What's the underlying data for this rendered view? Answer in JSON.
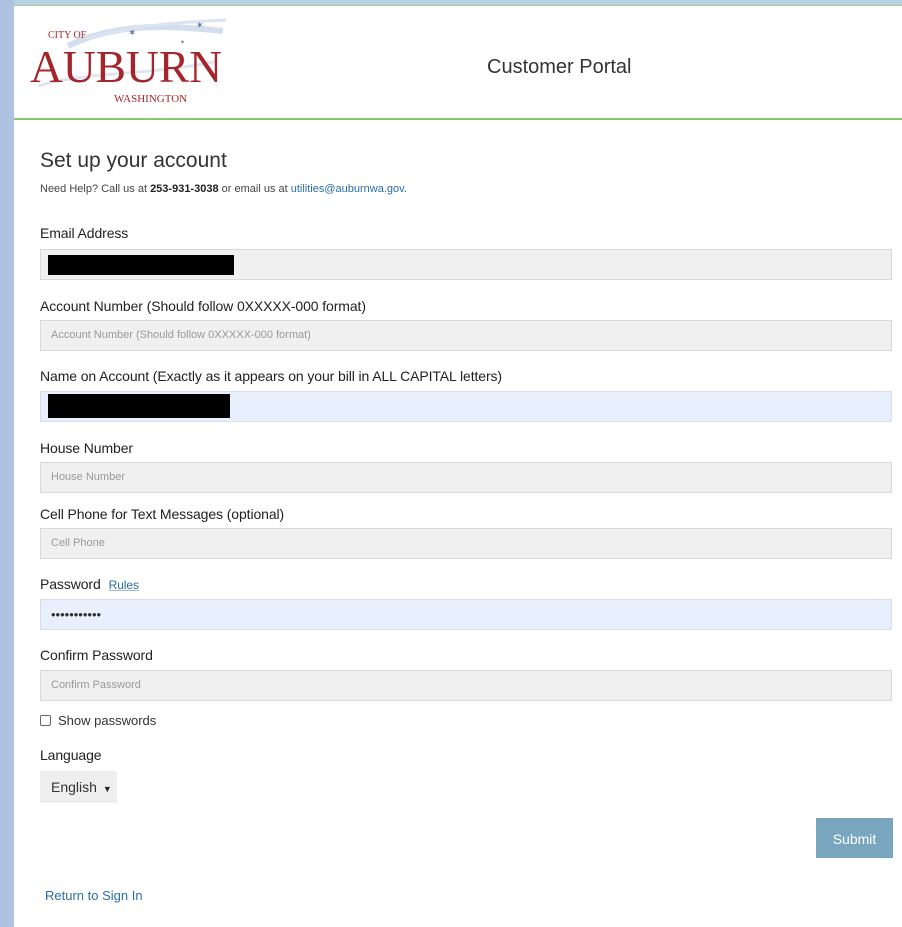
{
  "header": {
    "logo_city_of": "CITY OF",
    "logo_name": "AUBURN",
    "logo_state": "WASHINGTON",
    "portal_title": "Customer Portal"
  },
  "form": {
    "title": "Set up your account",
    "help_prefix": "Need Help? Call us at ",
    "help_phone": "253-931-3038",
    "help_middle": " or email us at ",
    "help_email": "utilities@auburnwa.gov",
    "help_suffix": ".",
    "fields": {
      "email": {
        "label": "Email Address",
        "value": ""
      },
      "account_number": {
        "label": "Account Number (Should follow 0XXXXX-000 format)",
        "placeholder": "Account Number (Should follow 0XXXXX-000 format)"
      },
      "name_on_account": {
        "label": "Name on Account (Exactly as it appears on your bill in ALL CAPITAL letters)",
        "value": ""
      },
      "house_number": {
        "label": "House Number",
        "placeholder": "House Number"
      },
      "cell_phone": {
        "label": "Cell Phone for Text Messages (optional)",
        "placeholder": "Cell Phone"
      },
      "password": {
        "label": "Password",
        "rules_link": "Rules",
        "value": "•••••••••••"
      },
      "confirm_password": {
        "label": "Confirm Password",
        "placeholder": "Confirm Password"
      }
    },
    "show_passwords_label": "Show passwords",
    "language_label": "Language",
    "language_selected": "English",
    "submit_label": "Submit",
    "return_link": "Return to Sign In"
  },
  "colors": {
    "header_rule": "#8cc66b",
    "link": "#2a6da8",
    "submit_bg": "#78a6bf",
    "logo_red": "#a4262c",
    "autofill_bg": "#e8f0fe"
  }
}
